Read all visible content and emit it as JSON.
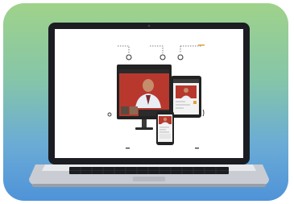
{
  "scene": {
    "description_icon": "laptop-video-call-illustration",
    "colors": {
      "card_top": "#9fd28a",
      "card_bottom": "#4f93d8",
      "laptop_frame": "#1b1d22",
      "keyboard_deck": "#c9ccd2",
      "screen_bg": "#ffffff",
      "accent_wall": "#b8382e"
    }
  }
}
